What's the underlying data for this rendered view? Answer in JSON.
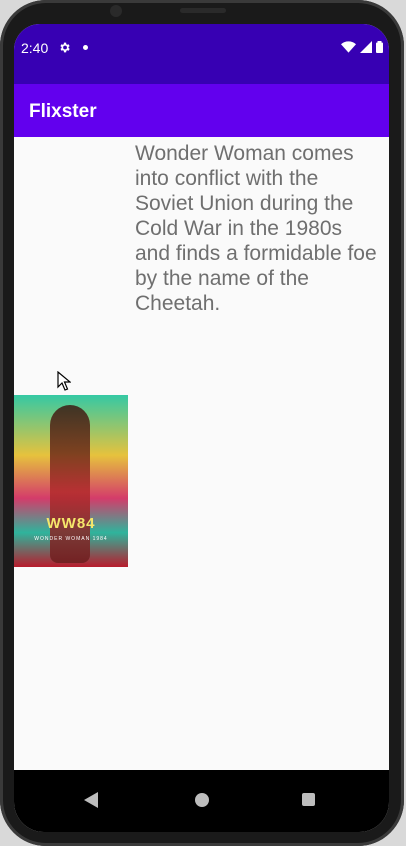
{
  "status_bar": {
    "time": "2:40",
    "icons": [
      "gear-icon",
      "notification-dot-icon",
      "wifi-icon",
      "signal-icon",
      "battery-icon"
    ]
  },
  "app_bar": {
    "title": "Flixster"
  },
  "movie": {
    "overview": "Wonder Woman comes into conflict with the Soviet Union during the Cold War in the 1980s and finds a formidable foe by the name of the Cheetah.",
    "poster_title": "WW84",
    "poster_subtitle": "WONDER WOMAN 1984"
  },
  "navigation": {
    "icons": [
      "back-icon",
      "home-icon",
      "recents-icon"
    ]
  },
  "colors": {
    "status_bar": "#3700b3",
    "app_bar": "#6200ee",
    "overview_text": "#6f6f6f",
    "background": "#fafafa"
  }
}
